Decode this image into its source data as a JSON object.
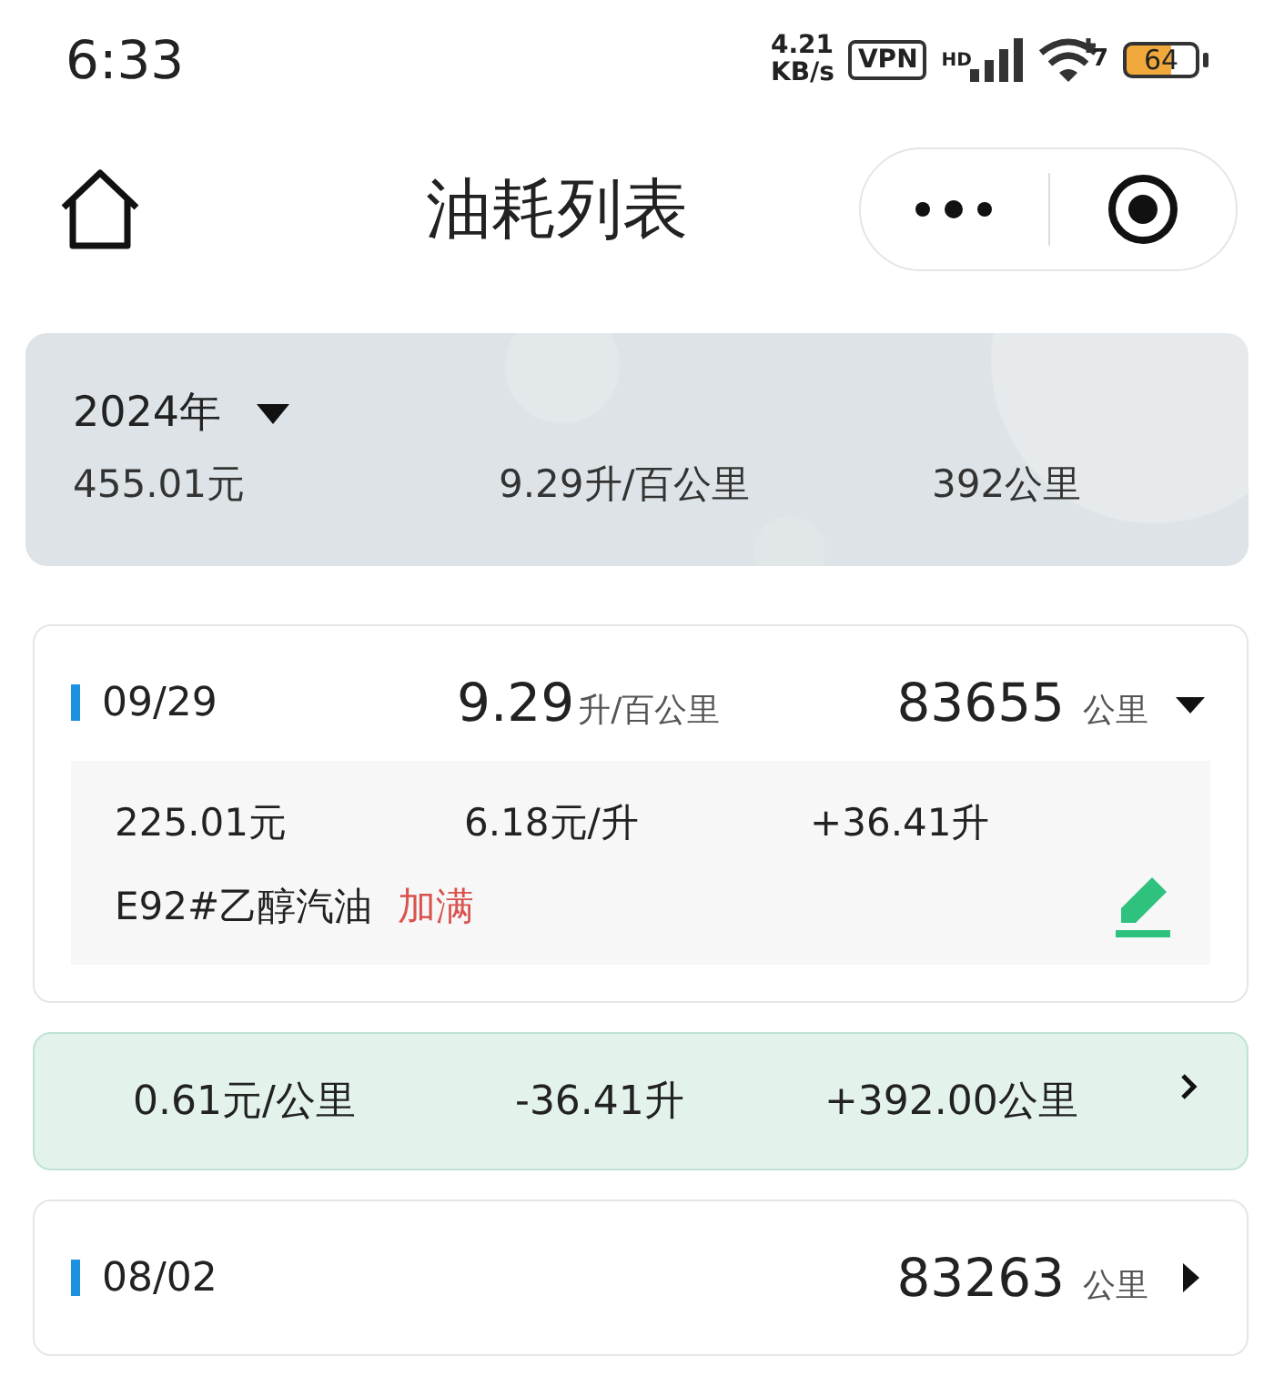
{
  "status_bar": {
    "time": "6:33",
    "speed": "4.21",
    "speed_unit": "KB/s",
    "vpn": "VPN",
    "hd": "HD",
    "wifi_badge": "7",
    "battery": "64"
  },
  "header": {
    "title": "油耗列表"
  },
  "summary": {
    "year": "2024年",
    "total_cost": "455.01元",
    "consumption": "9.29升/百公里",
    "distance": "392公里"
  },
  "entries": [
    {
      "kind": "record",
      "date": "09/29",
      "consumption": "9.29",
      "consumption_unit": "升/百公里",
      "odometer": "83655",
      "odometer_unit": "公里",
      "expanded": true,
      "cost": "225.01元",
      "price": "6.18元/升",
      "volume": "+36.41升",
      "fuel": "E92#乙醇汽油",
      "fill_tag": "加满"
    },
    {
      "kind": "interval",
      "cost_per_km": "0.61元/公里",
      "volume": "-36.41升",
      "distance": "+392.00公里"
    },
    {
      "kind": "record",
      "date": "08/02",
      "odometer": "83263",
      "odometer_unit": "公里",
      "expanded": false
    }
  ]
}
